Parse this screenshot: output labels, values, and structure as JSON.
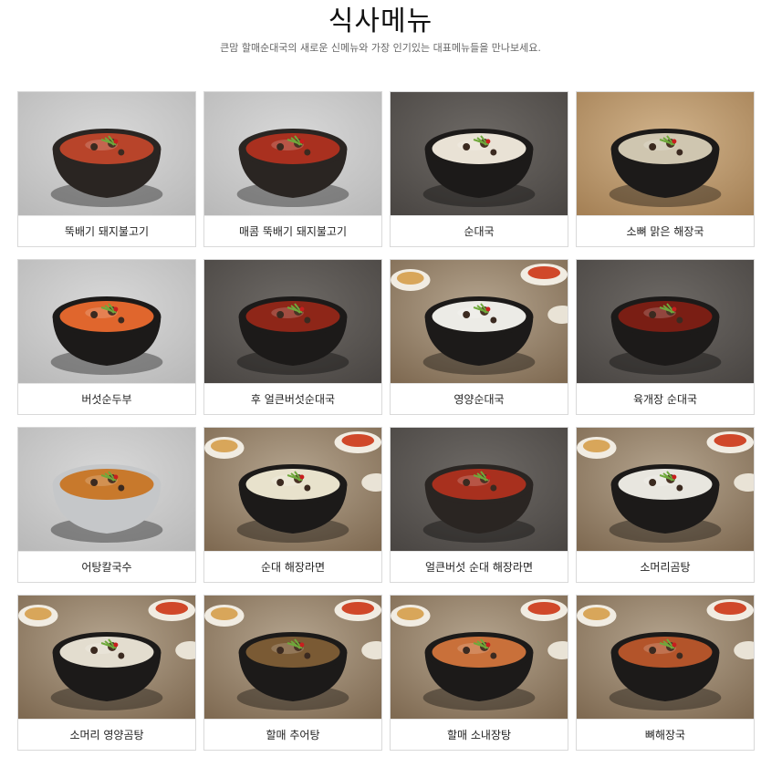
{
  "header": {
    "title": "식사메뉴",
    "subtitle": "큰맘 할매순대국의 새로운 신메뉴와 가장 인기있는 대표메뉴들을 만나보세요."
  },
  "menu": [
    {
      "label": "뚝배기 돼지불고기",
      "bg": "gray",
      "soup": "#b8442a",
      "bowl": "earthen"
    },
    {
      "label": "매콤 뚝배기 돼지불고기",
      "bg": "gray",
      "soup": "#a9301f",
      "bowl": "earthen"
    },
    {
      "label": "순대국",
      "bg": "dark",
      "soup": "#e9e2d5",
      "bowl": "black"
    },
    {
      "label": "소뼈 맑은 해장국",
      "bg": "tan",
      "soup": "#cfc6b0",
      "bowl": "black"
    },
    {
      "label": "버섯순두부",
      "bg": "gray",
      "soup": "#e0662d",
      "bowl": "black"
    },
    {
      "label": "후 얼큰버섯순대국",
      "bg": "dark",
      "soup": "#8e2618",
      "bowl": "black"
    },
    {
      "label": "영양순대국",
      "bg": "table",
      "soup": "#ecebe6",
      "bowl": "black"
    },
    {
      "label": "육개장 순대국",
      "bg": "dark",
      "soup": "#7a1e14",
      "bowl": "black"
    },
    {
      "label": "어탕칼국수",
      "bg": "gray",
      "soup": "#c8792c",
      "bowl": "steel"
    },
    {
      "label": "순대 해장라면",
      "bg": "table",
      "soup": "#e8e2cc",
      "bowl": "black"
    },
    {
      "label": "얼큰버섯 순대 해장라면",
      "bg": "dark",
      "soup": "#a8301e",
      "bowl": "earthen"
    },
    {
      "label": "소머리곰탕",
      "bg": "table",
      "soup": "#e8e6df",
      "bowl": "black"
    },
    {
      "label": "소머리 영양곰탕",
      "bg": "table",
      "soup": "#e3ddcf",
      "bowl": "black"
    },
    {
      "label": "할매 추어탕",
      "bg": "table",
      "soup": "#7a5a34",
      "bowl": "black"
    },
    {
      "label": "할매 소내장탕",
      "bg": "table",
      "soup": "#c9703a",
      "bowl": "black"
    },
    {
      "label": "뼈해장국",
      "bg": "table",
      "soup": "#b3542a",
      "bowl": "black"
    }
  ]
}
